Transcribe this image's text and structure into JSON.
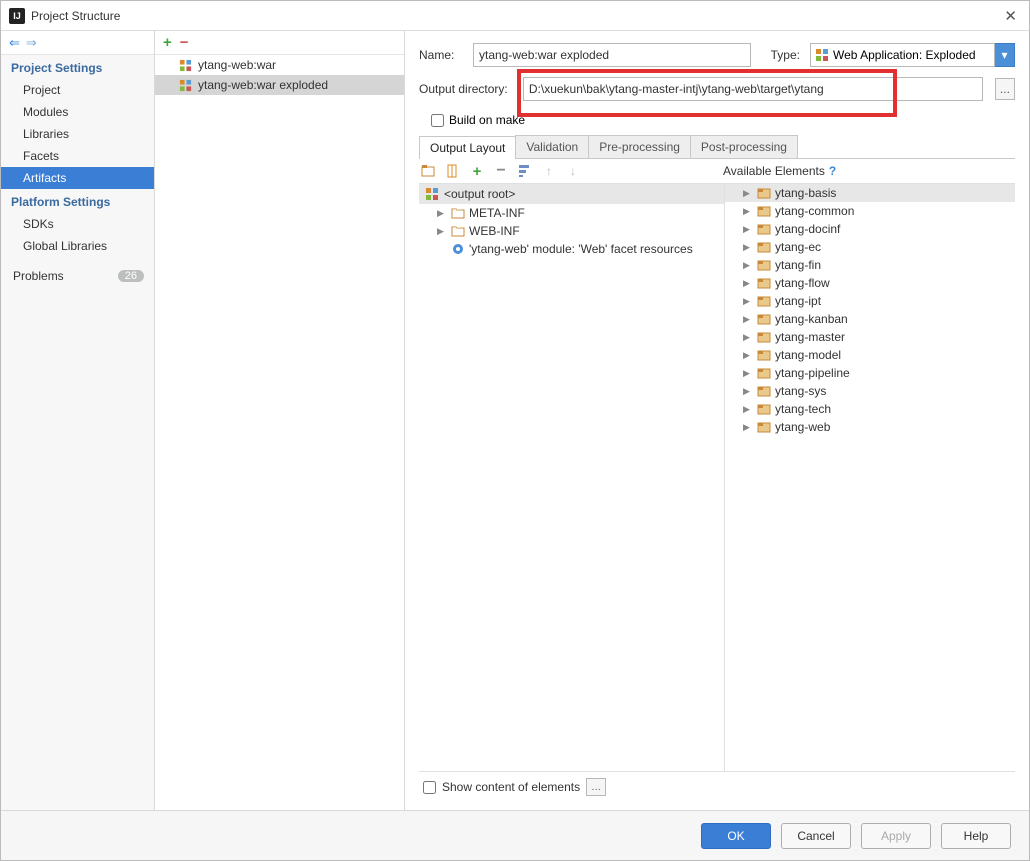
{
  "window": {
    "title": "Project Structure"
  },
  "sidebar": {
    "project_settings_hdr": "Project Settings",
    "items1": [
      "Project",
      "Modules",
      "Libraries",
      "Facets",
      "Artifacts"
    ],
    "items1_selected": 4,
    "platform_settings_hdr": "Platform Settings",
    "items2": [
      "SDKs",
      "Global Libraries"
    ],
    "problems": "Problems",
    "problems_count": "26"
  },
  "artifacts": {
    "items": [
      "ytang-web:war",
      "ytang-web:war exploded"
    ],
    "selected": 1
  },
  "form": {
    "name_label": "Name:",
    "name_value": "ytang-web:war exploded",
    "type_label": "Type:",
    "type_value": "Web Application: Exploded",
    "outdir_label": "Output directory:",
    "outdir_value": "D:\\xuekun\\bak\\ytang-master-intj\\ytang-web\\target\\ytang",
    "build_on_make": "Build on make",
    "browse_ellipsis": "..."
  },
  "tabs": {
    "items": [
      "Output Layout",
      "Validation",
      "Pre-processing",
      "Post-processing"
    ],
    "active": 0
  },
  "available_hdr": "Available Elements",
  "output_tree": {
    "root": "<output root>",
    "items": [
      {
        "label": "META-INF",
        "kind": "folder"
      },
      {
        "label": "WEB-INF",
        "kind": "folder"
      },
      {
        "label": "'ytang-web' module: 'Web' facet resources",
        "kind": "facet"
      }
    ]
  },
  "avail_tree": {
    "items": [
      "ytang-basis",
      "ytang-common",
      "ytang-docinf",
      "ytang-ec",
      "ytang-fin",
      "ytang-flow",
      "ytang-ipt",
      "ytang-kanban",
      "ytang-master",
      "ytang-model",
      "ytang-pipeline",
      "ytang-sys",
      "ytang-tech",
      "ytang-web"
    ],
    "selected": 0
  },
  "show_content": "Show content of elements",
  "buttons": {
    "ok": "OK",
    "cancel": "Cancel",
    "apply": "Apply",
    "help": "Help"
  }
}
